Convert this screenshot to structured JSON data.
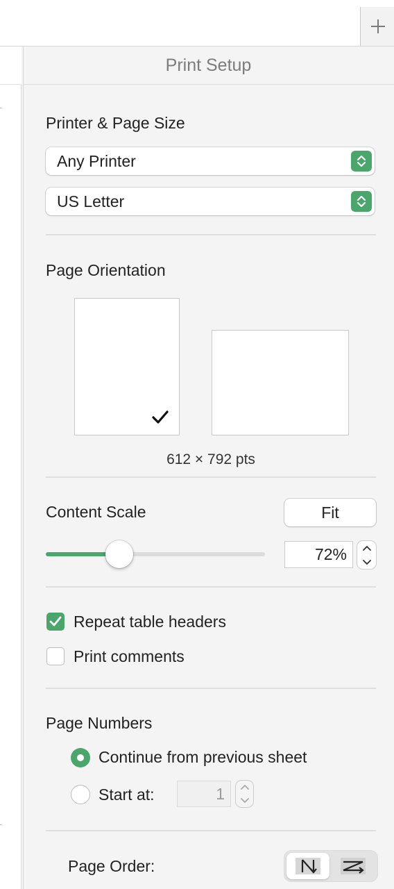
{
  "panel": {
    "title": "Print Setup"
  },
  "printer_section": {
    "title": "Printer & Page Size",
    "printer_value": "Any Printer",
    "page_size_value": "US Letter"
  },
  "orientation": {
    "title": "Page Orientation",
    "selected": "portrait",
    "dimensions": "612 × 792 pts"
  },
  "content_scale": {
    "title": "Content Scale",
    "fit_label": "Fit",
    "value": "72%",
    "slider_fraction": 0.33
  },
  "options": {
    "repeat_headers_label": "Repeat table headers",
    "repeat_headers_checked": true,
    "print_comments_label": "Print comments",
    "print_comments_checked": false
  },
  "page_numbers": {
    "title": "Page Numbers",
    "continue_label": "Continue from previous sheet",
    "start_at_label": "Start at:",
    "start_at_value": "1",
    "selected": "continue"
  },
  "page_order": {
    "label": "Page Order:",
    "selected": "down-then-over"
  },
  "colors": {
    "accent": "#4aa66a",
    "panel_bg": "#f4f4f4"
  },
  "icons": {
    "add": "plus-icon",
    "popup": "up-down-chevron-icon",
    "check": "checkmark-icon"
  }
}
